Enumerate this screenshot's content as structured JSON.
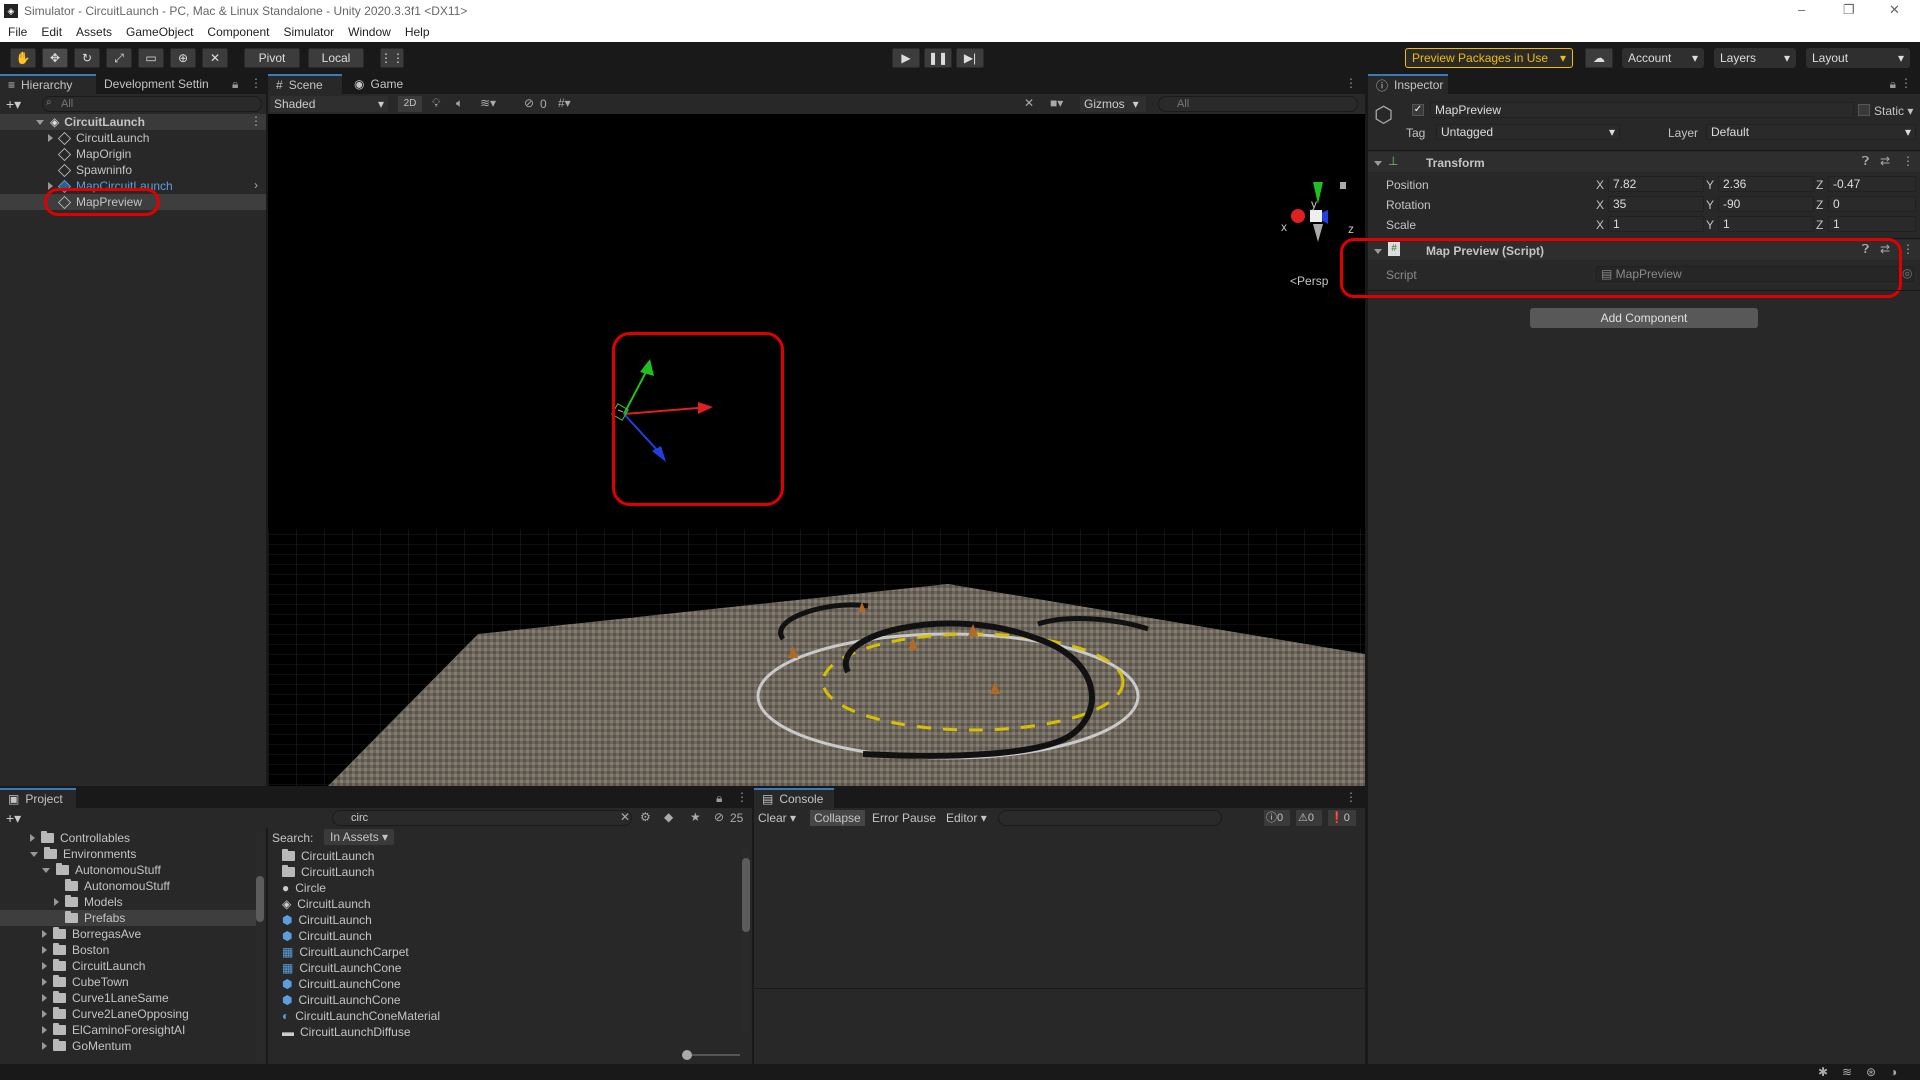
{
  "window": {
    "title": "Simulator - CircuitLaunch - PC, Mac & Linux Standalone - Unity 2020.3.3f1 <DX11>",
    "logo_glyph": "◈",
    "controls": [
      "–",
      "❐",
      "✕"
    ]
  },
  "menu": [
    "File",
    "Edit",
    "Assets",
    "GameObject",
    "Component",
    "Simulator",
    "Window",
    "Help"
  ],
  "toolbar": {
    "pivot": "Pivot",
    "local": "Local",
    "preview_packages": "Preview Packages in Use",
    "account": "Account",
    "layers": "Layers",
    "layout": "Layout"
  },
  "hierarchy": {
    "tabs": [
      "Hierarchy",
      "Development Settin"
    ],
    "search_placeholder": "All",
    "scene": "CircuitLaunch",
    "items": [
      "CircuitLaunch",
      "MapOrigin",
      "Spawninfo",
      "MapCircuitLaunch",
      "MapPreview"
    ]
  },
  "scene_view": {
    "tabs": [
      "Scene",
      "Game"
    ],
    "shading": "Shaded",
    "mode_2d": "2D",
    "hidden_count": "0",
    "gizmos": "Gizmos",
    "search_placeholder": "All",
    "persp": "Persp",
    "axis_labels": {
      "y": "y",
      "x": "x",
      "z": "z"
    }
  },
  "inspector": {
    "tab": "Inspector",
    "object_name": "MapPreview",
    "static": "Static",
    "tag_label": "Tag",
    "tag_value": "Untagged",
    "layer_label": "Layer",
    "layer_value": "Default",
    "transform": {
      "title": "Transform",
      "rows": [
        {
          "label": "Position",
          "x": "7.82",
          "y": "2.36",
          "z": "-0.47"
        },
        {
          "label": "Rotation",
          "x": "35",
          "y": "-90",
          "z": "0"
        },
        {
          "label": "Scale",
          "x": "1",
          "y": "1",
          "z": "1"
        }
      ],
      "axis": {
        "x": "X",
        "y": "Y",
        "z": "Z"
      }
    },
    "script_component": {
      "title": "Map Preview (Script)",
      "script_label": "Script",
      "script_value": "MapPreview"
    },
    "add_component": "Add Component"
  },
  "project": {
    "tab": "Project",
    "search_value": "circ",
    "hidden_count": "25",
    "search_label": "Search:",
    "search_scope": "In Assets",
    "tree": [
      {
        "label": "Controllables",
        "depth": 1,
        "arrow": "right"
      },
      {
        "label": "Environments",
        "depth": 1,
        "arrow": "down"
      },
      {
        "label": "AutonomouStuff",
        "depth": 2,
        "arrow": "down"
      },
      {
        "label": "AutonomouStuff",
        "depth": 3,
        "arrow": "none"
      },
      {
        "label": "Models",
        "depth": 3,
        "arrow": "right"
      },
      {
        "label": "Prefabs",
        "depth": 3,
        "arrow": "none",
        "selected": true
      },
      {
        "label": "BorregasAve",
        "depth": 2,
        "arrow": "right"
      },
      {
        "label": "Boston",
        "depth": 2,
        "arrow": "right"
      },
      {
        "label": "CircuitLaunch",
        "depth": 2,
        "arrow": "right"
      },
      {
        "label": "CubeTown",
        "depth": 2,
        "arrow": "right"
      },
      {
        "label": "Curve1LaneSame",
        "depth": 2,
        "arrow": "right"
      },
      {
        "label": "Curve2LaneOpposing",
        "depth": 2,
        "arrow": "right"
      },
      {
        "label": "ElCaminoForesightAI",
        "depth": 2,
        "arrow": "right"
      },
      {
        "label": "GoMentum",
        "depth": 2,
        "arrow": "right"
      }
    ],
    "results": [
      {
        "label": "CircuitLaunch",
        "icon": "folder"
      },
      {
        "label": "CircuitLaunch",
        "icon": "folder"
      },
      {
        "label": "Circle",
        "icon": "circle"
      },
      {
        "label": "CircuitLaunch",
        "icon": "scene"
      },
      {
        "label": "CircuitLaunch",
        "icon": "prefab"
      },
      {
        "label": "CircuitLaunch",
        "icon": "prefab"
      },
      {
        "label": "CircuitLaunchCarpet",
        "icon": "grid"
      },
      {
        "label": "CircuitLaunchCone",
        "icon": "grid"
      },
      {
        "label": "CircuitLaunchCone",
        "icon": "prefab"
      },
      {
        "label": "CircuitLaunchCone",
        "icon": "prefab"
      },
      {
        "label": "CircuitLaunchConeMaterial",
        "icon": "material"
      },
      {
        "label": "CircuitLaunchDiffuse",
        "icon": "texture"
      }
    ]
  },
  "console": {
    "tab": "Console",
    "clear": "Clear",
    "collapse": "Collapse",
    "error_pause": "Error Pause",
    "editor": "Editor",
    "counts": {
      "log": "0",
      "warn": "0",
      "error": "0"
    }
  },
  "colors": {
    "accent": "#3a79bb",
    "annotation": "#e00000",
    "preview_packages": "#f4bc02"
  }
}
